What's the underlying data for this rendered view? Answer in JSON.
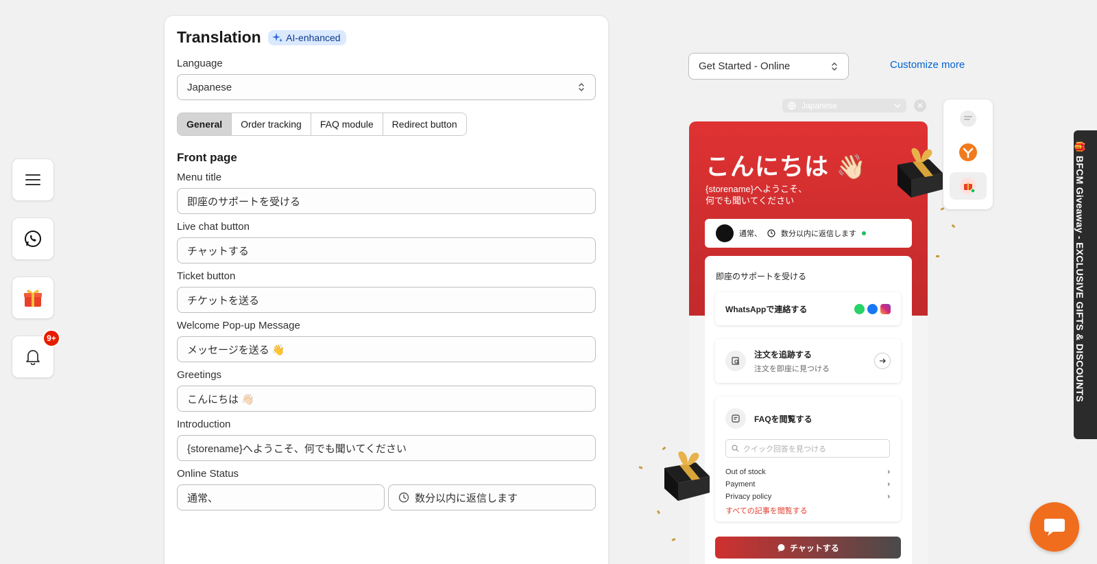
{
  "left_rail": {
    "notification_badge": "9+"
  },
  "translation": {
    "title": "Translation",
    "ai_badge": "AI-enhanced",
    "language_label": "Language",
    "language_value": "Japanese",
    "tabs": [
      "General",
      "Order tracking",
      "FAQ module",
      "Redirect button"
    ],
    "active_tab": "General",
    "section_title": "Front page",
    "fields": {
      "menu_title": {
        "label": "Menu title",
        "value": "即座のサポートを受ける"
      },
      "live_chat_button": {
        "label": "Live chat button",
        "value": "チャットする"
      },
      "ticket_button": {
        "label": "Ticket button",
        "value": "チケットを送る"
      },
      "welcome_popup": {
        "label": "Welcome Pop-up Message",
        "value": "メッセージを送る 👋"
      },
      "greetings": {
        "label": "Greetings",
        "value": "こんにちは 👋🏻"
      },
      "introduction": {
        "label": "Introduction",
        "value": "{storename}へようこそ、何でも聞いてください"
      }
    },
    "online_status": {
      "label": "Online Status",
      "status_value": "通常、",
      "reply_value": "数分以内に返信します"
    }
  },
  "preview": {
    "preset_select": "Get Started - Online",
    "customize_link": "Customize more",
    "language_pill": "Japanese",
    "widget": {
      "greeting": "こんにちは 👋🏻",
      "intro_line1": "{storename}へようこそ、",
      "intro_line2": "何でも聞いてください",
      "status_text": "通常、",
      "reply_text": "数分以内に返信します",
      "menu_title": "即座のサポートを受ける",
      "whatsapp_text": "WhatsAppで連絡する",
      "track_title": "注文を追跡する",
      "track_subtitle": "注文を即座に見つける",
      "faq_title": "FAQを閲覧する",
      "faq_search_placeholder": "クイック回答を見つける",
      "faq_items": [
        "Out of stock",
        "Payment",
        "Privacy policy"
      ],
      "faq_all_link": "すべての記事を閲覧する",
      "chat_button": "チャットする"
    }
  },
  "bfcm_banner": "🎁 BFCM Giveaway - EXCLUSIVE GIFTS & DISCOUNTS",
  "colors": {
    "widget_red": "#df3233",
    "link_blue": "#0062d1",
    "chat_fab_orange": "#f06d1d",
    "badge_red": "#e51c00"
  }
}
